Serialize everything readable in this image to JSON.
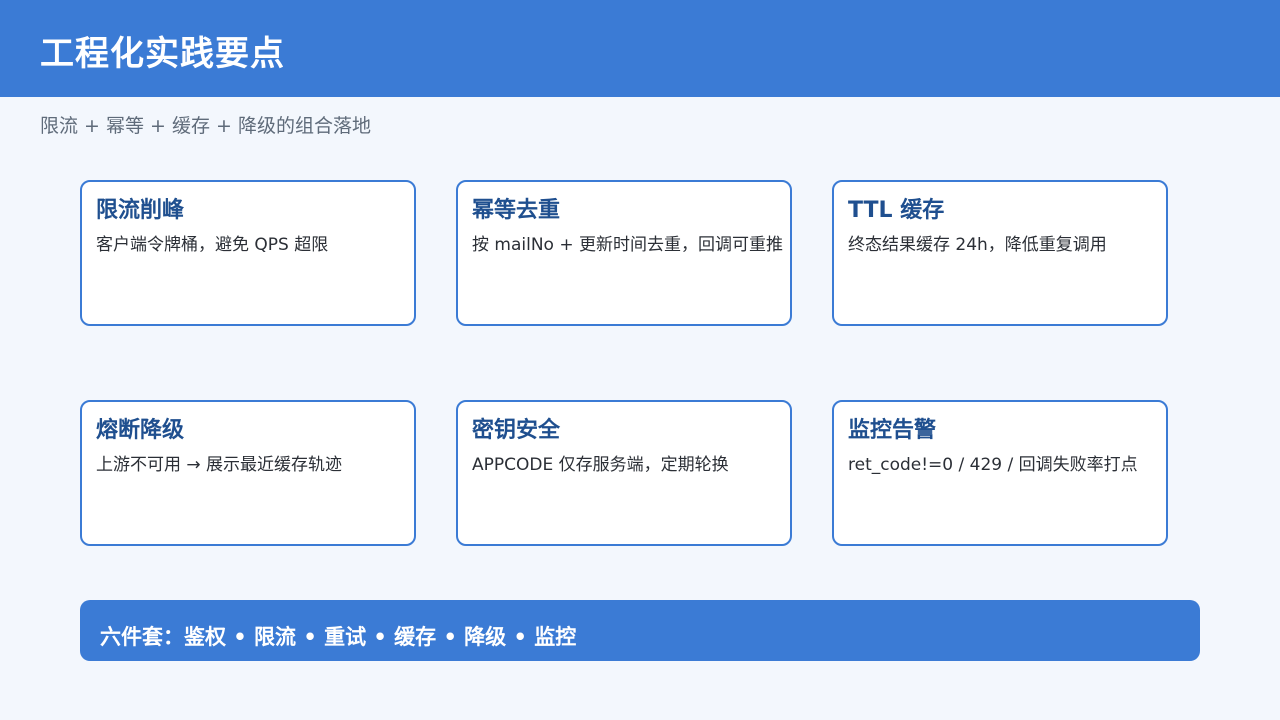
{
  "header": {
    "title": "工程化实践要点"
  },
  "subtitle": "限流 + 幂等 + 缓存 + 降级的组合落地",
  "cards": [
    {
      "title": "限流削峰",
      "body": "客户端令牌桶，避免 QPS 超限"
    },
    {
      "title": "幂等去重",
      "body": "按 mailNo + 更新时间去重，回调可重推"
    },
    {
      "title": "TTL 缓存",
      "body": "终态结果缓存 24h，降低重复调用"
    },
    {
      "title": "熔断降级",
      "body": "上游不可用 → 展示最近缓存轨迹"
    },
    {
      "title": "密钥安全",
      "body": "APPCODE 仅存服务端，定期轮换"
    },
    {
      "title": "监控告警",
      "body": "ret_code!=0 / 429 / 回调失败率打点"
    }
  ],
  "footer": {
    "text": "六件套：鉴权 • 限流 • 重试 • 缓存 • 降级 • 监控"
  },
  "colors": {
    "accent": "#3b7bd5",
    "card_title": "#1f4f8f",
    "background": "#f3f7fd"
  }
}
